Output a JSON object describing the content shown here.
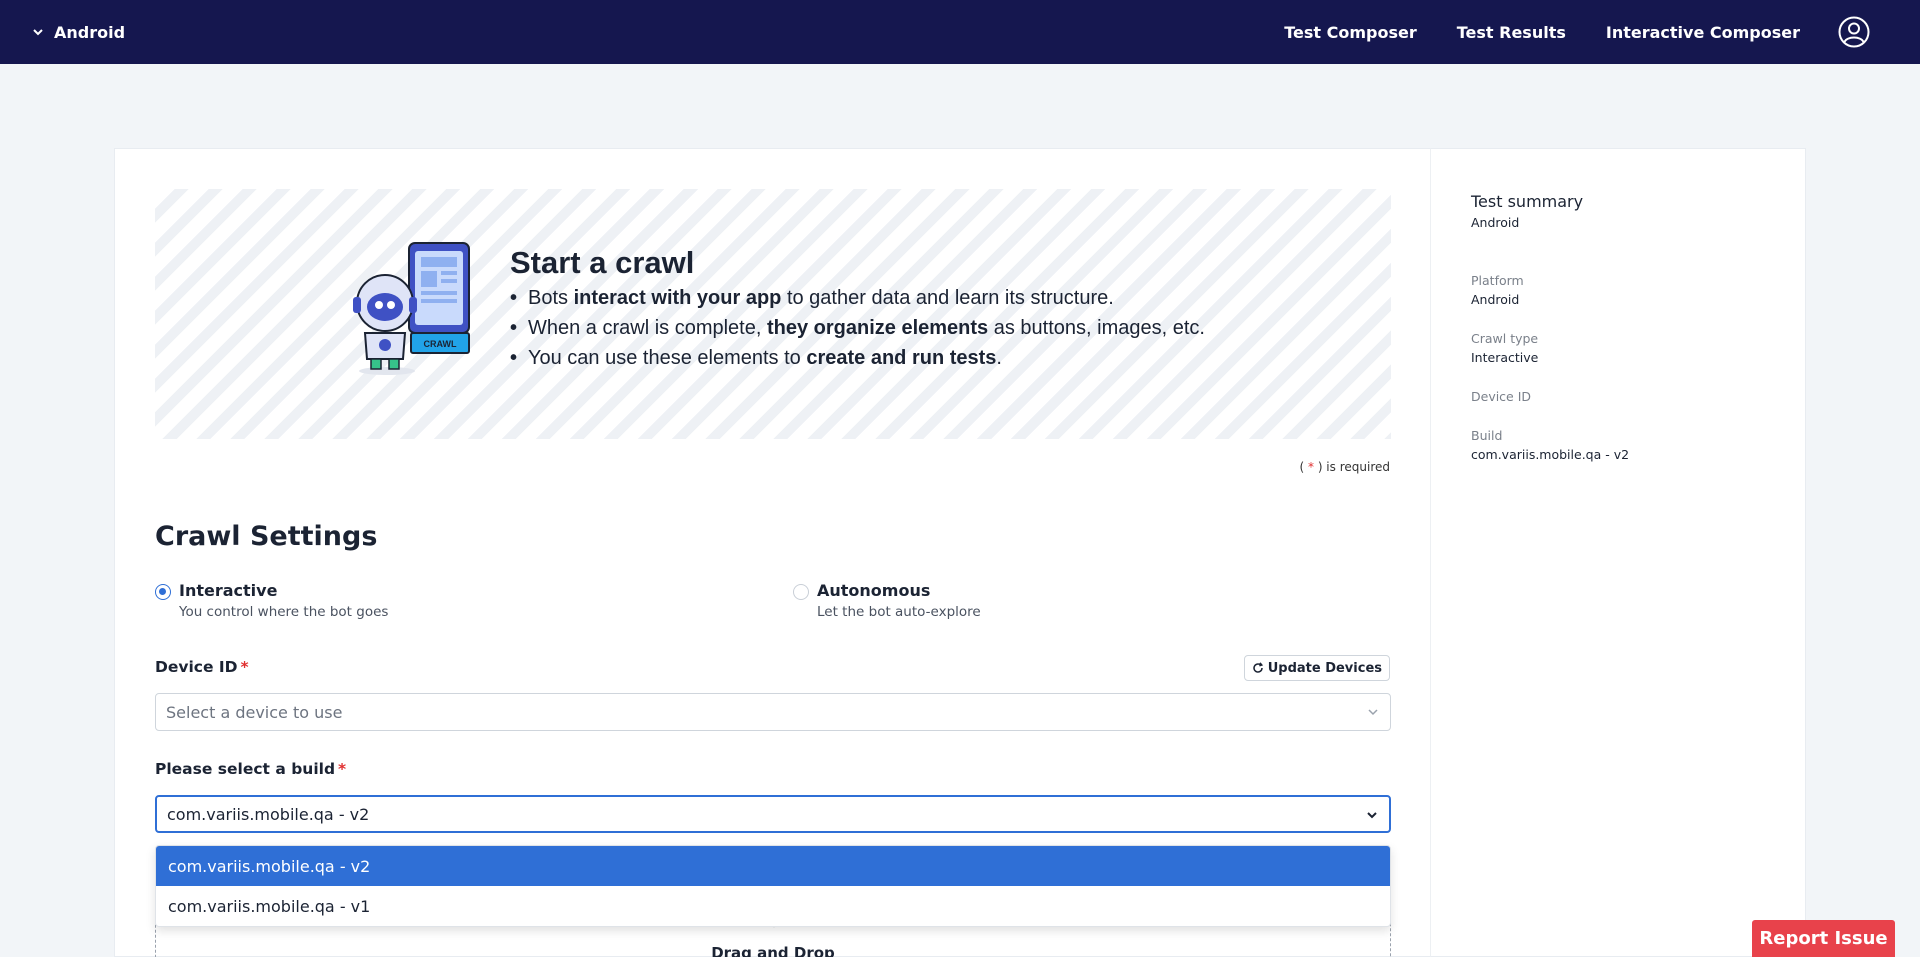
{
  "topbar": {
    "platform": "Android",
    "nav": [
      {
        "label": "Test Composer"
      },
      {
        "label": "Test Results"
      },
      {
        "label": "Interactive Composer"
      }
    ]
  },
  "hero": {
    "title": "Start a crawl",
    "robot_badge": "CRAWL",
    "bullets": [
      {
        "pre": "Bots ",
        "bold": "interact with your app",
        "post": " to gather data and learn its structure."
      },
      {
        "pre": "When a crawl is complete, ",
        "bold": "they organize elements",
        "post": " as buttons, images, etc."
      },
      {
        "pre": "You can use these elements to ",
        "bold": "create and run tests",
        "post": "."
      }
    ]
  },
  "required_note": {
    "open": "( ",
    "star": "*",
    "close": " ) is required"
  },
  "crawl_settings": {
    "title": "Crawl Settings",
    "options": [
      {
        "label": "Interactive",
        "description": "You control where the bot goes",
        "checked": true
      },
      {
        "label": "Autonomous",
        "description": "Let the bot auto-explore",
        "checked": false
      }
    ],
    "device": {
      "label": "Device ID",
      "required_mark": "*",
      "update_button": "Update Devices",
      "placeholder": "Select a device to use"
    },
    "build": {
      "label": "Please select a build",
      "required_mark": "*",
      "value": "com.variis.mobile.qa - v2",
      "options": [
        "com.variis.mobile.qa - v2",
        "com.variis.mobile.qa - v1"
      ],
      "active_index": 0
    },
    "dropzone": {
      "text": "Drag and Drop"
    }
  },
  "summary": {
    "title": "Test summary",
    "subtitle": "Android",
    "items": [
      {
        "label": "Platform",
        "value": "Android"
      },
      {
        "label": "Crawl type",
        "value": "Interactive"
      },
      {
        "label": "Device ID",
        "value": ""
      },
      {
        "label": "Build",
        "value": "com.variis.mobile.qa - v2"
      }
    ]
  },
  "report_button": "Report Issue",
  "colors": {
    "nav_bg": "#15174f",
    "accent": "#2f6fd6",
    "required": "#e03030",
    "report": "#e8424b"
  }
}
